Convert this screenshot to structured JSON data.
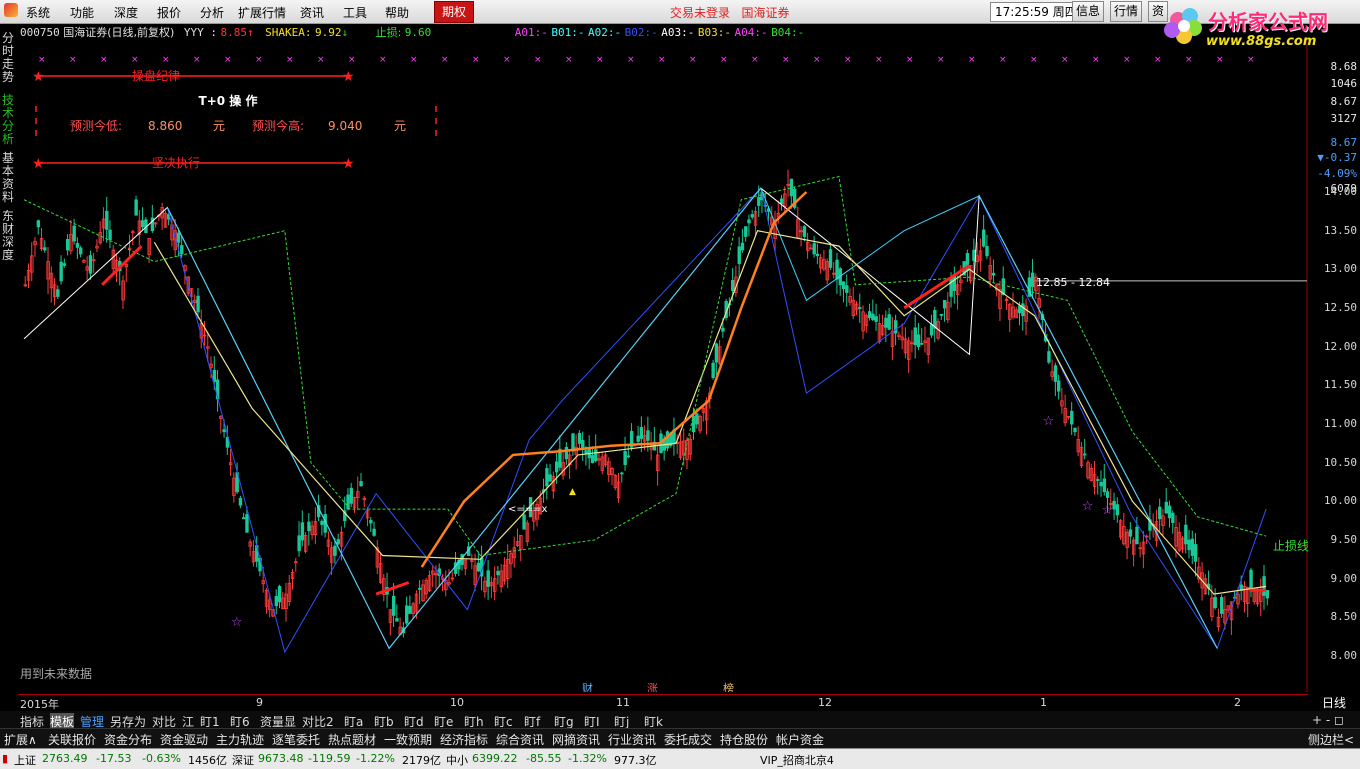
{
  "menu": {
    "items": [
      "系统",
      "功能",
      "深度",
      "报价",
      "分析",
      "扩展行情",
      "资讯",
      "工具",
      "帮助"
    ],
    "qiquan": "期权"
  },
  "status": {
    "login": "交易未登录",
    "broker": "国海证券"
  },
  "clock": {
    "time": "17:25:59",
    "weekday": "周四"
  },
  "top_buttons": [
    "信息",
    "行情",
    "资"
  ],
  "brand": {
    "name": "分析家公式网",
    "url": "www.88gs.com"
  },
  "sidebar": {
    "tabs": [
      "分时走势",
      "技术分析",
      "基本资料",
      "东财深度"
    ]
  },
  "infobar": {
    "code": "000750",
    "name": "国海证券(日线,前复权)",
    "yyy_label": "YYY :",
    "yyy_value": "8.85",
    "shakea_label": "SHAKEA:",
    "shakea_value": "9.92",
    "stop_label": "止损:",
    "stop_value": "9.60",
    "a01": "A01:",
    "b01": "B01:",
    "a02": "A02:",
    "b02": "B02:",
    "a03": "A03:",
    "b03": "B03:",
    "a04": "A04:",
    "b04": "B04:",
    "dash": "-"
  },
  "annotations": {
    "discipline": "操盘纪律",
    "t0": "T+0 操 作",
    "pred_low_label": "预测今低:",
    "pred_low": "8.860",
    "pred_high_label": "预测今高:",
    "pred_high": "9.040",
    "unit": "元",
    "execute": "坚决执行",
    "future_data": "用到未来数据",
    "range_label": "12.85 - 12.84",
    "stop_line": "止损线",
    "arrow": "<===x",
    "events": [
      "财",
      "涨",
      "榜"
    ]
  },
  "yaxis": {
    "top_labels": [
      {
        "text": "8.68",
        "color": "#e8e8e8"
      },
      {
        "text": "1046",
        "color": "#e8e8e8"
      },
      {
        "text": "8.67",
        "color": "#e8e8e8"
      },
      {
        "text": "3127",
        "color": "#e8e8e8"
      },
      {
        "text": "8.67",
        "color": "#4aa0ff"
      },
      {
        "text": "▼-0.37",
        "color": "#4aa0ff"
      },
      {
        "text": "-4.09%",
        "color": "#4aa0ff"
      },
      {
        "text": "6079",
        "color": "#e8e8e8"
      }
    ],
    "ticks": [
      "14.00",
      "13.50",
      "13.00",
      "12.50",
      "12.00",
      "11.50",
      "11.00",
      "10.50",
      "10.00",
      "9.50",
      "9.00",
      "8.50",
      "8.00"
    ]
  },
  "xaxis": {
    "labels": [
      "2015年",
      "9",
      "10",
      "11",
      "12",
      "1",
      "2"
    ],
    "period": "日线"
  },
  "toolbar1": [
    "指标",
    "模板",
    "管理",
    "另存为",
    "对比",
    "江",
    "盯1",
    "盯6",
    "资量显",
    "对比2",
    "盯a",
    "盯b",
    "盯d",
    "盯e",
    "盯h",
    "盯c",
    "盯f",
    "盯g",
    "盯I",
    "盯j",
    "盯k"
  ],
  "toolbar1_right": "+ - ◻",
  "toolbar2": [
    "扩展∧",
    "关联报价",
    "资金分布",
    "资金驱动",
    "主力轨迹",
    "逐笔委托",
    "热点题材",
    "一致预期",
    "经济指标",
    "综合资讯",
    "网摘资讯",
    "行业资讯",
    "委托成交",
    "持仓股份",
    "帐户资金"
  ],
  "toolbar2_right": "侧边栏<",
  "statusbar": {
    "sh_label": "上证",
    "sh_value": "2763.49",
    "sh_change": "-17.53",
    "sh_pct": "-0.63%",
    "sh_amount": "1456亿",
    "sz_label": "深证",
    "sz_value": "9673.48",
    "sz_change": "-119.59",
    "sz_pct": "-1.22%",
    "sz_amount": "2179亿",
    "zx_label": "中小",
    "zx_value": "6399.22",
    "zx_change": "-85.55",
    "zx_pct": "-1.32%",
    "zx_amount": "977.3亿",
    "vip": "VIP_招商北京4"
  },
  "chart_data": {
    "type": "candlestick",
    "yrange": [
      8.0,
      14.0
    ],
    "points": [
      [
        0,
        12.8
      ],
      [
        4,
        13.55
      ],
      [
        10,
        12.65
      ],
      [
        14,
        13.45
      ],
      [
        20,
        12.95
      ],
      [
        24,
        13.65
      ],
      [
        30,
        12.85
      ],
      [
        34,
        13.7
      ],
      [
        38,
        13.4
      ],
      [
        42,
        13.8
      ],
      [
        46,
        13.5
      ],
      [
        52,
        12.6
      ],
      [
        56,
        12.0
      ],
      [
        60,
        11.1
      ],
      [
        64,
        10.3
      ],
      [
        68,
        9.6
      ],
      [
        72,
        9.1
      ],
      [
        76,
        8.6
      ],
      [
        80,
        8.8
      ],
      [
        85,
        9.5
      ],
      [
        90,
        9.8
      ],
      [
        95,
        9.3
      ],
      [
        99,
        9.9
      ],
      [
        103,
        10.2
      ],
      [
        108,
        9.4
      ],
      [
        112,
        8.6
      ],
      [
        116,
        8.3
      ],
      [
        120,
        8.8
      ],
      [
        125,
        9.1
      ],
      [
        130,
        8.95
      ],
      [
        136,
        9.3
      ],
      [
        142,
        8.9
      ],
      [
        146,
        9.1
      ],
      [
        150,
        9.4
      ],
      [
        155,
        9.8
      ],
      [
        160,
        10.2
      ],
      [
        165,
        10.5
      ],
      [
        170,
        10.75
      ],
      [
        174,
        10.5
      ],
      [
        178,
        10.6
      ],
      [
        182,
        10.25
      ],
      [
        186,
        10.7
      ],
      [
        190,
        10.85
      ],
      [
        194,
        10.6
      ],
      [
        199,
        10.75
      ],
      [
        204,
        10.8
      ],
      [
        210,
        11.4
      ],
      [
        214,
        12.2
      ],
      [
        218,
        12.9
      ],
      [
        222,
        13.6
      ],
      [
        226,
        13.9
      ],
      [
        230,
        13.6
      ],
      [
        234,
        14.1
      ],
      [
        238,
        13.5
      ],
      [
        242,
        13.2
      ],
      [
        246,
        13.1
      ],
      [
        250,
        12.8
      ],
      [
        254,
        12.6
      ],
      [
        258,
        12.4
      ],
      [
        262,
        12.3
      ],
      [
        266,
        12.2
      ],
      [
        270,
        12.1
      ],
      [
        274,
        12.0
      ],
      [
        278,
        12.15
      ],
      [
        282,
        12.5
      ],
      [
        286,
        12.8
      ],
      [
        290,
        13.05
      ],
      [
        294,
        13.3
      ],
      [
        298,
        12.8
      ],
      [
        302,
        12.55
      ],
      [
        306,
        12.4
      ],
      [
        310,
        12.9
      ],
      [
        314,
        11.8
      ],
      [
        318,
        11.3
      ],
      [
        322,
        10.9
      ],
      [
        326,
        10.5
      ],
      [
        330,
        10.2
      ],
      [
        334,
        9.9
      ],
      [
        338,
        9.6
      ],
      [
        342,
        9.4
      ],
      [
        346,
        9.7
      ],
      [
        350,
        9.85
      ],
      [
        354,
        9.6
      ],
      [
        358,
        9.3
      ],
      [
        362,
        9.0
      ],
      [
        366,
        8.5
      ],
      [
        370,
        8.7
      ],
      [
        374,
        8.9
      ],
      [
        378,
        8.85
      ],
      [
        381,
        8.75
      ]
    ],
    "ma": [
      [
        40,
        13.35
      ],
      [
        70,
        11.2
      ],
      [
        110,
        9.3
      ],
      [
        140,
        9.25
      ],
      [
        170,
        10.6
      ],
      [
        200,
        10.75
      ],
      [
        225,
        13.5
      ],
      [
        250,
        13.3
      ],
      [
        270,
        12.4
      ],
      [
        290,
        13.0
      ],
      [
        310,
        12.4
      ],
      [
        340,
        10.0
      ],
      [
        365,
        8.8
      ],
      [
        381,
        8.9
      ]
    ],
    "orange_line": [
      [
        122,
        9.15
      ],
      [
        135,
        10.0
      ],
      [
        150,
        10.6
      ],
      [
        165,
        10.65
      ],
      [
        180,
        10.72
      ],
      [
        195,
        10.75
      ],
      [
        210,
        11.3
      ],
      [
        220,
        12.5
      ],
      [
        230,
        13.6
      ],
      [
        240,
        14.0
      ]
    ]
  }
}
